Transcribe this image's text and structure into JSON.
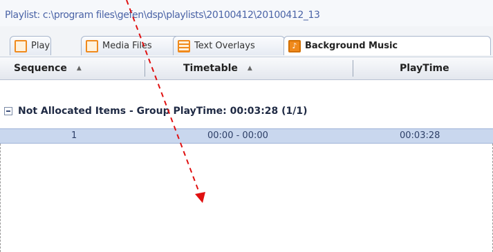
{
  "path": {
    "text": "Playlist: c:\\program files\\gefen\\dsp\\playlists\\20100412\\20100412_13"
  },
  "tabs": [
    {
      "label": "Playlists",
      "icon": "playlist-icon"
    },
    {
      "label": "Media Files",
      "icon": "media-files-icon"
    },
    {
      "label": "Text Overlays",
      "icon": "text-overlays-icon"
    },
    {
      "label": "Background Music",
      "icon": "background-music-icon",
      "active": true
    }
  ],
  "columns": {
    "sequence": "Sequence",
    "timetable": "Timetable",
    "playtime": "PlayTime",
    "sort_glyph": "▲"
  },
  "group": {
    "label": "Not Allocated Items - Group PlayTime: 00:03:28 (1/1)"
  },
  "rows": [
    {
      "sequence": "1",
      "timetable": "00:00 - 00:00",
      "playtime": "00:03:28"
    }
  ],
  "colors": {
    "annotation_arrow": "#e01010",
    "selected_row": "#c9d7ee",
    "tab_accent": "#f08a1c"
  }
}
